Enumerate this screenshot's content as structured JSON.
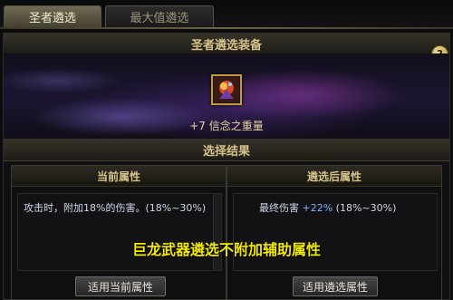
{
  "tabs": [
    {
      "label": "圣者遴选",
      "active": true
    },
    {
      "label": "最大值遴选",
      "active": false
    }
  ],
  "equip_section": {
    "title": "圣者遴选装备",
    "help_symbol": "?",
    "item": {
      "name": "+7 信念之重量",
      "icon": "staff-weapon-icon",
      "border_color": "#c29a38"
    }
  },
  "result_section": {
    "title": "选择结果"
  },
  "current_panel": {
    "title": "当前属性",
    "stat": "攻击时，附加18%的伤害。(18%~30%)",
    "button": "适用当前属性"
  },
  "after_panel": {
    "title": "遴选后属性",
    "stat_label": "最终伤害",
    "stat_value": "+22%",
    "stat_range": "(18%~30%)",
    "button": "适用遴选属性"
  },
  "overlay_text": "巨龙武器遴选不附加辅助属性",
  "colors": {
    "accent_gold": "#d6c48a",
    "overlay_yellow": "#f2ea00",
    "stat_plus_blue": "#7fb2ff"
  }
}
